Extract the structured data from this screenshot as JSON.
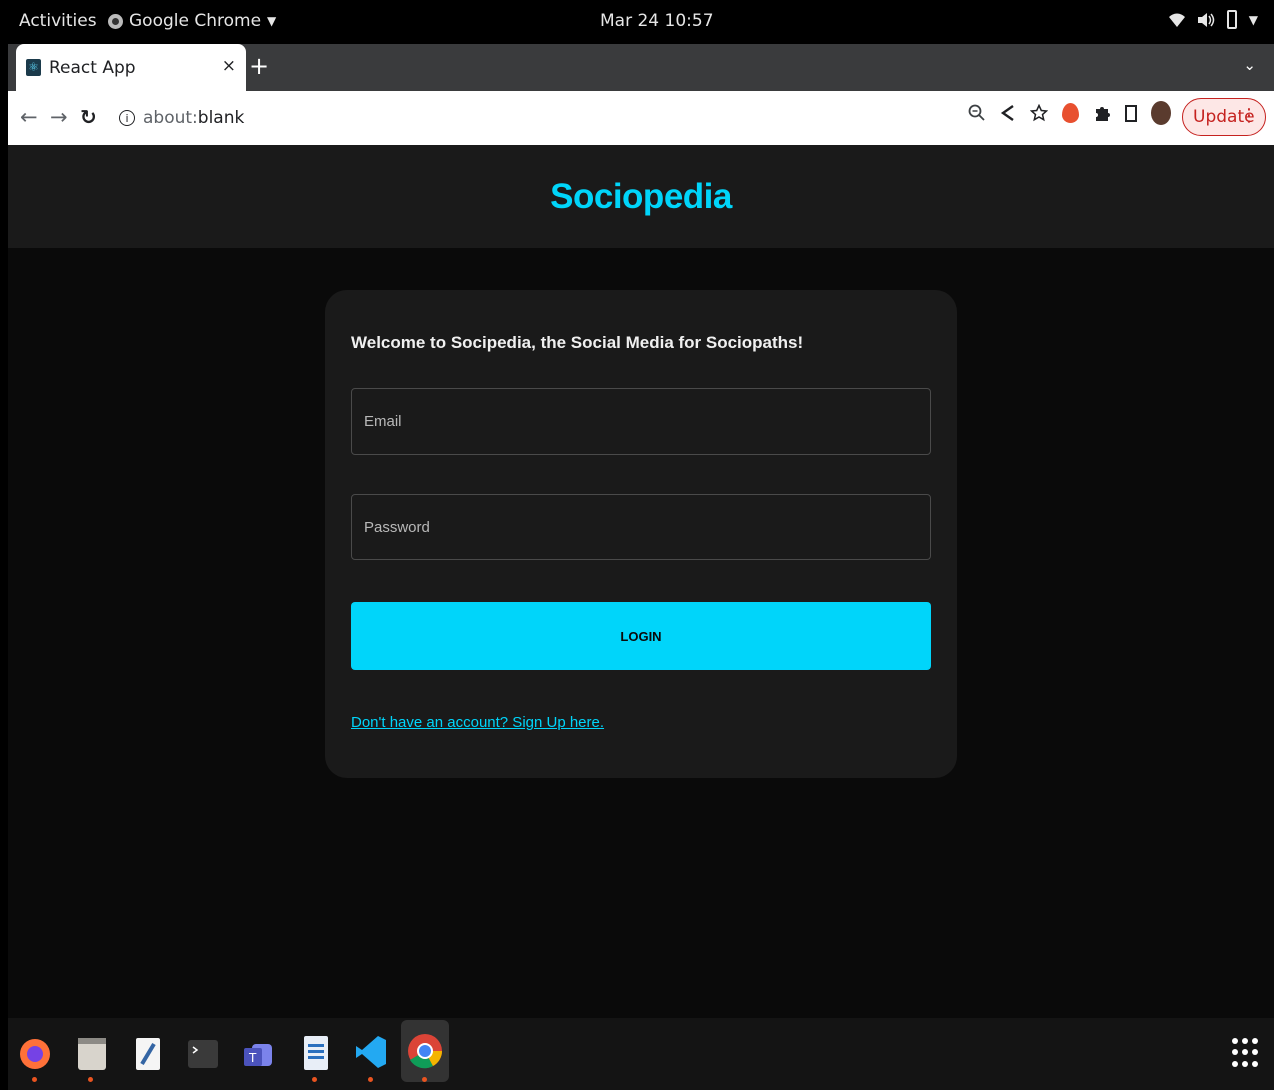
{
  "topbar": {
    "activities": "Activities",
    "app_name": "Google Chrome",
    "clock": "Mar 24  10:57"
  },
  "browser": {
    "tab_title": "React App",
    "tab_close": "×",
    "new_tab": "+",
    "tab_search": "⌄",
    "url_scheme": "about:",
    "url_rest": "blank",
    "update_label": "Update"
  },
  "page": {
    "brand": "Sociopedia",
    "welcome": "Welcome to Socipedia, the Social Media for Sociopaths!",
    "email_placeholder": "Email",
    "password_placeholder": "Password",
    "login_label": "LOGIN",
    "signup_link": "Don't have an account? Sign Up here."
  },
  "colors": {
    "accent": "#00d5fa",
    "page_bg": "#0a0a0a",
    "card_bg": "#1a1a1a",
    "update_red": "#c5221f"
  },
  "dock": {
    "apps": [
      "firefox-icon",
      "files-icon",
      "text-editor-icon",
      "terminal-icon",
      "teams-icon",
      "libreoffice-writer-icon",
      "vscode-icon",
      "chrome-icon"
    ],
    "active": "chrome-icon"
  }
}
